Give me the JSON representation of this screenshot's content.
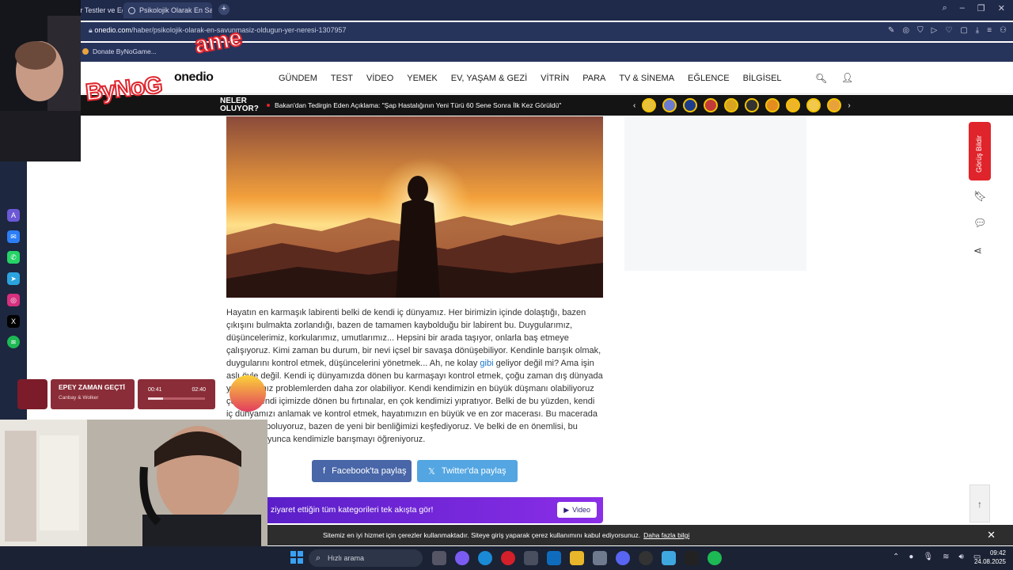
{
  "browser": {
    "tabs": [
      {
        "label": "En Popüler Testler ve Eğle"
      },
      {
        "label": "Psikolojik Olarak En Savun"
      }
    ],
    "url_domain": "onedio.com",
    "url_path": "/haber/psikolojik-olarak-en-savunmasiz-oldugun-yer-neresi-1307957",
    "bookmark": "Donate ByNoGame..."
  },
  "site": {
    "logo": "onedio",
    "nav": [
      "GÜNDEM",
      "TEST",
      "VİDEO",
      "YEMEK",
      "EV, YAŞAM & GEZİ",
      "VİTRİN",
      "PARA",
      "TV & SİNEMA",
      "EĞLENCE",
      "BİLGİSEL"
    ],
    "news_label_1": "NELER",
    "news_label_2": "OLUYOR?",
    "ticker": "Bakan'dan Tedirgin Eden Açıklama: \"Şap Hastalığının Yeni Türü 60 Sene Sonra İlk Kez Görüldü\""
  },
  "article": {
    "p1": "Hayatın en karmaşık labirenti belki de kendi iç dünyamız. Her birimizin içinde dolaştığı, bazen çıkışını bulmakta zorlandığı, bazen de tamamen kaybolduğu bir labirent bu. Duygularımız, düşüncelerimiz, korkularımız, umutlarımız... Hepsini bir arada taşıyor, onlarla baş etmeye çalışıyoruz. Kimi zaman bu durum, bir nevi içsel bir savaşa dönüşebiliyor. Kendinle barışık olmak, duygularını kontrol etmek, düşüncelerini yönetmek... Ah, ne kolay ",
    "link": "gibi",
    "p2": " geliyor değil mi? Ama işin aslı öyle değil. Kendi iç dünyamızda dönen bu karmaşayı kontrol etmek, çoğu zaman dış dünyada yaşadığımız problemlerden daha zor olabiliyor. Kendi kendimizin en büyük düşmanı olabiliyoruz çünkü. Kendi içimizde dönen bu fırtınalar, en çok kendimizi yıpratıyor. Belki de bu yüzden, kendi iç dünyamızı anlamak ve kontrol etmek, hayatımızın en büyük ve en zor macerası. Bu macerada bazen kayboluyoruz, bazen de yeni bir benliğimizi keşfediyoruz. Ve belki de en önemlisi, bu macera boyunca kendimizle barışmayı öğreniyoruz."
  },
  "share": {
    "facebook": "Facebook'ta paylaş",
    "twitter": "Twitter'da paylaş"
  },
  "promo": {
    "text": "ziyaret ettiğin tüm kategorileri tek akışta gör!",
    "button": "Video"
  },
  "dock": {
    "feedback": "Görüş Bildir"
  },
  "cookie": {
    "text": "Sitemiz en iyi hizmet için çerezler kullanmaktadır. Siteye giriş yaparak çerez kullanımını kabul ediyorsunuz.",
    "link": "Daha fazla bilgi"
  },
  "taskbar": {
    "search": "Hızlı arama",
    "time": "09:42",
    "date": "24.08.2025"
  },
  "overlay": {
    "brand": "ByNoG",
    "brand2": "ame",
    "music": {
      "title": "EPEY ZAMAN GEÇTİ",
      "artist": "Canbay & Wolker",
      "elapsed": "00:41",
      "total": "02:40",
      "progress": 0.26
    }
  },
  "colors": {
    "accent": "#e0242c",
    "promo_start": "#5a1fc8",
    "facebook": "#4866a8",
    "twitter": "#53a6e2"
  }
}
